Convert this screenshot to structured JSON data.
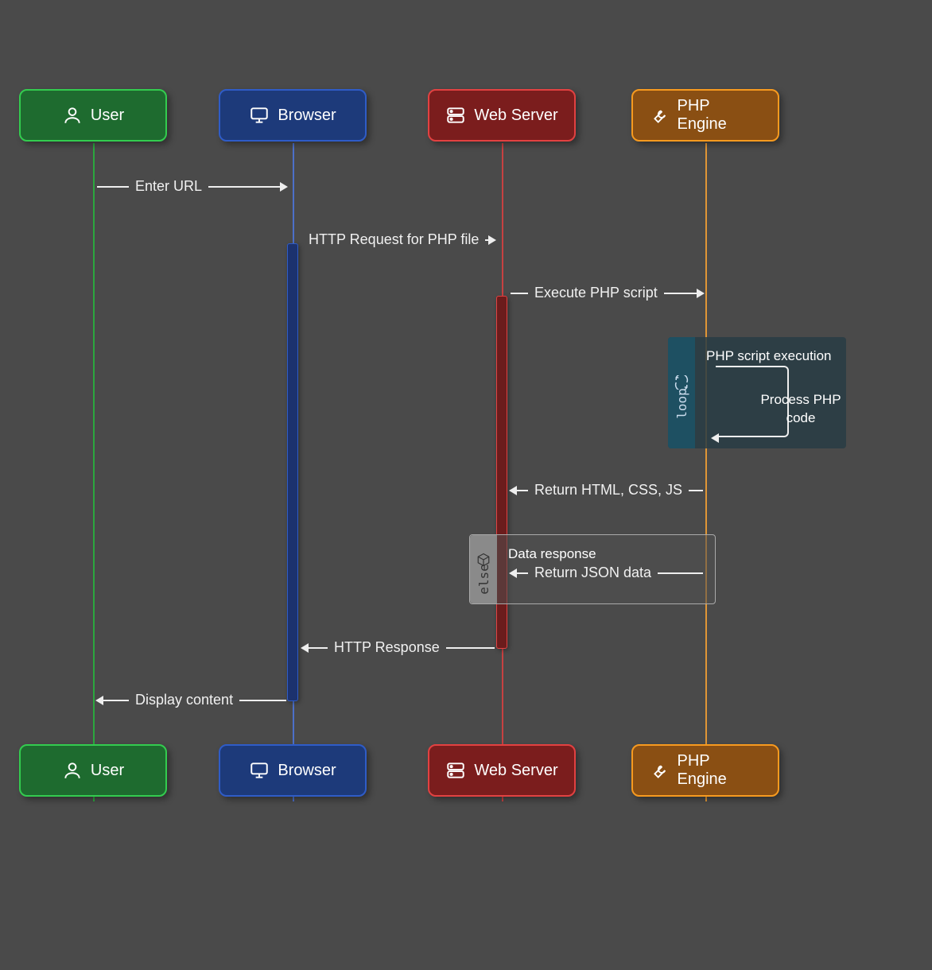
{
  "participants": {
    "user": {
      "label": "User",
      "color_bg": "#1e6b2f",
      "color_border": "#33cc4f",
      "icon": "user-icon"
    },
    "browser": {
      "label": "Browser",
      "color_bg": "#1d3a7a",
      "color_border": "#2f5cc7",
      "icon": "monitor-icon"
    },
    "server": {
      "label": "Web Server",
      "color_bg": "#7b1d1d",
      "color_border": "#e24141",
      "icon": "server-icon"
    },
    "php": {
      "label": "PHP Engine",
      "color_bg": "#8a4f13",
      "color_border": "#f79a1f",
      "icon": "wrench-icon"
    }
  },
  "messages": {
    "m1": {
      "from": "user",
      "to": "browser",
      "label": "Enter URL",
      "direction": "right"
    },
    "m2": {
      "from": "browser",
      "to": "server",
      "label": "HTTP Request for PHP file",
      "direction": "right"
    },
    "m3": {
      "from": "server",
      "to": "php",
      "label": "Execute PHP script",
      "direction": "right"
    },
    "m4": {
      "from": "php",
      "to": "server",
      "label": "Return HTML, CSS, JS",
      "direction": "left"
    },
    "m5": {
      "from": "php",
      "to": "server",
      "label": "Return JSON data",
      "direction": "left"
    },
    "m6": {
      "from": "server",
      "to": "browser",
      "label": "HTTP Response",
      "direction": "left"
    },
    "m7": {
      "from": "browser",
      "to": "user",
      "label": "Display content",
      "direction": "left"
    }
  },
  "fragments": {
    "loop": {
      "type": "loop",
      "tag_label": "loop",
      "title": "PHP script execution",
      "self_message": "Process PHP code",
      "participant": "php"
    },
    "alt_else": {
      "type": "else",
      "tag_label": "else",
      "title": "Data response",
      "contains_message": "m5"
    }
  },
  "chart_data": {
    "type": "sequence_diagram",
    "participants": [
      "User",
      "Browser",
      "Web Server",
      "PHP Engine"
    ],
    "interactions": [
      {
        "from": "User",
        "to": "Browser",
        "label": "Enter URL"
      },
      {
        "from": "Browser",
        "to": "Web Server",
        "label": "HTTP Request for PHP file"
      },
      {
        "from": "Web Server",
        "to": "PHP Engine",
        "label": "Execute PHP script"
      },
      {
        "fragment": "loop",
        "title": "PHP script execution",
        "over": "PHP Engine",
        "body": [
          {
            "from": "PHP Engine",
            "to": "PHP Engine",
            "label": "Process PHP code"
          }
        ]
      },
      {
        "from": "PHP Engine",
        "to": "Web Server",
        "label": "Return HTML, CSS, JS"
      },
      {
        "fragment": "else",
        "title": "Data response",
        "body": [
          {
            "from": "PHP Engine",
            "to": "Web Server",
            "label": "Return JSON data"
          }
        ]
      },
      {
        "from": "Web Server",
        "to": "Browser",
        "label": "HTTP Response"
      },
      {
        "from": "Browser",
        "to": "User",
        "label": "Display content"
      }
    ]
  }
}
